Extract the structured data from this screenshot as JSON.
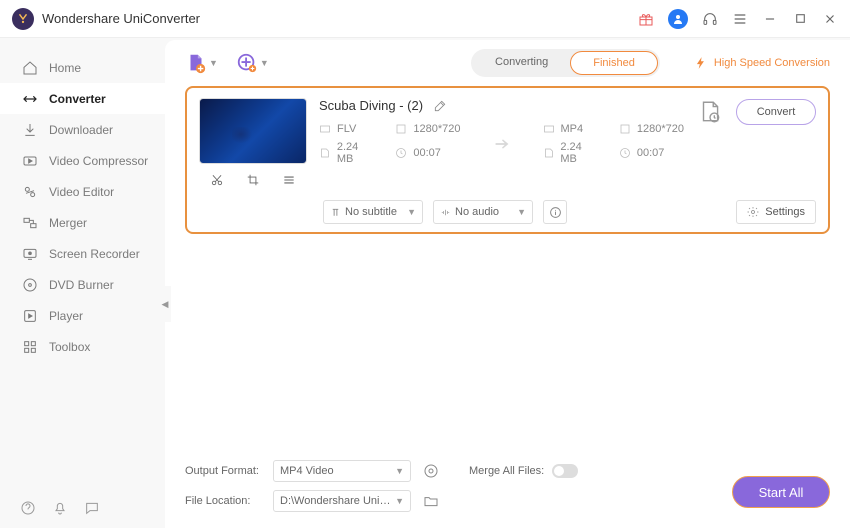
{
  "app": {
    "title": "Wondershare UniConverter"
  },
  "window_icons": {
    "gift": "gift-icon",
    "user": "user-icon",
    "headset": "headset-icon",
    "menu": "menu-icon",
    "min": "minimize-icon",
    "max": "maximize-icon",
    "close": "close-icon"
  },
  "sidebar": {
    "items": [
      {
        "label": "Home"
      },
      {
        "label": "Converter"
      },
      {
        "label": "Downloader"
      },
      {
        "label": "Video Compressor"
      },
      {
        "label": "Video Editor"
      },
      {
        "label": "Merger"
      },
      {
        "label": "Screen Recorder"
      },
      {
        "label": "DVD Burner"
      },
      {
        "label": "Player"
      },
      {
        "label": "Toolbox"
      }
    ]
  },
  "tabs": {
    "converting": "Converting",
    "finished": "Finished"
  },
  "high_speed": "High Speed Conversion",
  "file": {
    "name": "Scuba Diving - (2)",
    "src": {
      "format": "FLV",
      "res": "1280*720",
      "size": "2.24 MB",
      "dur": "00:07"
    },
    "dst": {
      "format": "MP4",
      "res": "1280*720",
      "size": "2.24 MB",
      "dur": "00:07"
    },
    "subtitle": "No subtitle",
    "audio": "No audio",
    "settings": "Settings",
    "convert": "Convert"
  },
  "footer": {
    "output_format_label": "Output Format:",
    "output_format_value": "MP4 Video",
    "file_location_label": "File Location:",
    "file_location_value": "D:\\Wondershare UniConverter",
    "merge_label": "Merge All Files:",
    "start": "Start All"
  }
}
